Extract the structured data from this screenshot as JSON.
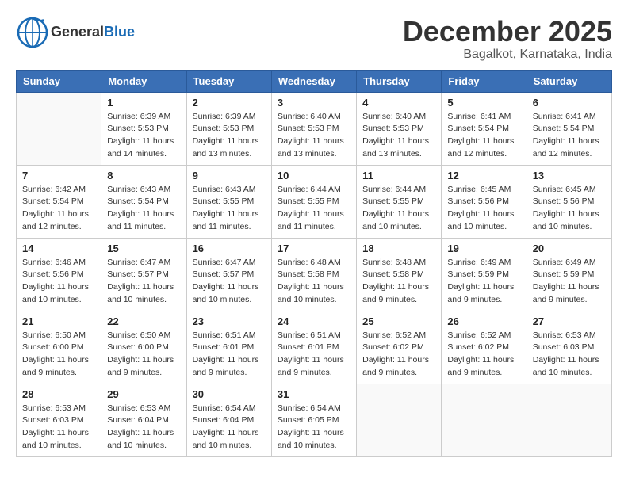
{
  "header": {
    "logo_general": "General",
    "logo_blue": "Blue",
    "month": "December 2025",
    "location": "Bagalkot, Karnataka, India"
  },
  "days_of_week": [
    "Sunday",
    "Monday",
    "Tuesday",
    "Wednesday",
    "Thursday",
    "Friday",
    "Saturday"
  ],
  "weeks": [
    [
      {
        "day": "",
        "info": ""
      },
      {
        "day": "1",
        "info": "Sunrise: 6:39 AM\nSunset: 5:53 PM\nDaylight: 11 hours\nand 14 minutes."
      },
      {
        "day": "2",
        "info": "Sunrise: 6:39 AM\nSunset: 5:53 PM\nDaylight: 11 hours\nand 13 minutes."
      },
      {
        "day": "3",
        "info": "Sunrise: 6:40 AM\nSunset: 5:53 PM\nDaylight: 11 hours\nand 13 minutes."
      },
      {
        "day": "4",
        "info": "Sunrise: 6:40 AM\nSunset: 5:53 PM\nDaylight: 11 hours\nand 13 minutes."
      },
      {
        "day": "5",
        "info": "Sunrise: 6:41 AM\nSunset: 5:54 PM\nDaylight: 11 hours\nand 12 minutes."
      },
      {
        "day": "6",
        "info": "Sunrise: 6:41 AM\nSunset: 5:54 PM\nDaylight: 11 hours\nand 12 minutes."
      }
    ],
    [
      {
        "day": "7",
        "info": "Sunrise: 6:42 AM\nSunset: 5:54 PM\nDaylight: 11 hours\nand 12 minutes."
      },
      {
        "day": "8",
        "info": "Sunrise: 6:43 AM\nSunset: 5:54 PM\nDaylight: 11 hours\nand 11 minutes."
      },
      {
        "day": "9",
        "info": "Sunrise: 6:43 AM\nSunset: 5:55 PM\nDaylight: 11 hours\nand 11 minutes."
      },
      {
        "day": "10",
        "info": "Sunrise: 6:44 AM\nSunset: 5:55 PM\nDaylight: 11 hours\nand 11 minutes."
      },
      {
        "day": "11",
        "info": "Sunrise: 6:44 AM\nSunset: 5:55 PM\nDaylight: 11 hours\nand 10 minutes."
      },
      {
        "day": "12",
        "info": "Sunrise: 6:45 AM\nSunset: 5:56 PM\nDaylight: 11 hours\nand 10 minutes."
      },
      {
        "day": "13",
        "info": "Sunrise: 6:45 AM\nSunset: 5:56 PM\nDaylight: 11 hours\nand 10 minutes."
      }
    ],
    [
      {
        "day": "14",
        "info": "Sunrise: 6:46 AM\nSunset: 5:56 PM\nDaylight: 11 hours\nand 10 minutes."
      },
      {
        "day": "15",
        "info": "Sunrise: 6:47 AM\nSunset: 5:57 PM\nDaylight: 11 hours\nand 10 minutes."
      },
      {
        "day": "16",
        "info": "Sunrise: 6:47 AM\nSunset: 5:57 PM\nDaylight: 11 hours\nand 10 minutes."
      },
      {
        "day": "17",
        "info": "Sunrise: 6:48 AM\nSunset: 5:58 PM\nDaylight: 11 hours\nand 10 minutes."
      },
      {
        "day": "18",
        "info": "Sunrise: 6:48 AM\nSunset: 5:58 PM\nDaylight: 11 hours\nand 9 minutes."
      },
      {
        "day": "19",
        "info": "Sunrise: 6:49 AM\nSunset: 5:59 PM\nDaylight: 11 hours\nand 9 minutes."
      },
      {
        "day": "20",
        "info": "Sunrise: 6:49 AM\nSunset: 5:59 PM\nDaylight: 11 hours\nand 9 minutes."
      }
    ],
    [
      {
        "day": "21",
        "info": "Sunrise: 6:50 AM\nSunset: 6:00 PM\nDaylight: 11 hours\nand 9 minutes."
      },
      {
        "day": "22",
        "info": "Sunrise: 6:50 AM\nSunset: 6:00 PM\nDaylight: 11 hours\nand 9 minutes."
      },
      {
        "day": "23",
        "info": "Sunrise: 6:51 AM\nSunset: 6:01 PM\nDaylight: 11 hours\nand 9 minutes."
      },
      {
        "day": "24",
        "info": "Sunrise: 6:51 AM\nSunset: 6:01 PM\nDaylight: 11 hours\nand 9 minutes."
      },
      {
        "day": "25",
        "info": "Sunrise: 6:52 AM\nSunset: 6:02 PM\nDaylight: 11 hours\nand 9 minutes."
      },
      {
        "day": "26",
        "info": "Sunrise: 6:52 AM\nSunset: 6:02 PM\nDaylight: 11 hours\nand 9 minutes."
      },
      {
        "day": "27",
        "info": "Sunrise: 6:53 AM\nSunset: 6:03 PM\nDaylight: 11 hours\nand 10 minutes."
      }
    ],
    [
      {
        "day": "28",
        "info": "Sunrise: 6:53 AM\nSunset: 6:03 PM\nDaylight: 11 hours\nand 10 minutes."
      },
      {
        "day": "29",
        "info": "Sunrise: 6:53 AM\nSunset: 6:04 PM\nDaylight: 11 hours\nand 10 minutes."
      },
      {
        "day": "30",
        "info": "Sunrise: 6:54 AM\nSunset: 6:04 PM\nDaylight: 11 hours\nand 10 minutes."
      },
      {
        "day": "31",
        "info": "Sunrise: 6:54 AM\nSunset: 6:05 PM\nDaylight: 11 hours\nand 10 minutes."
      },
      {
        "day": "",
        "info": ""
      },
      {
        "day": "",
        "info": ""
      },
      {
        "day": "",
        "info": ""
      }
    ]
  ]
}
